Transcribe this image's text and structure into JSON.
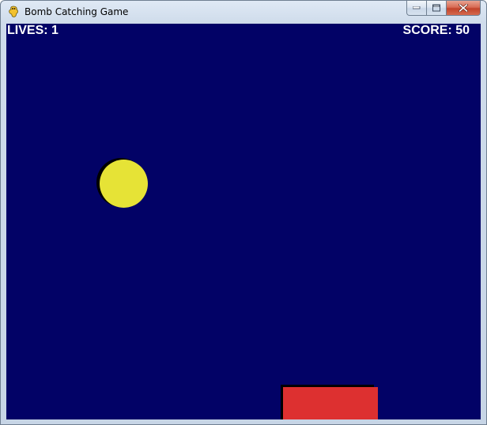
{
  "window": {
    "title": "Bomb Catching Game",
    "icon": "pygame-snake-icon",
    "controls": {
      "minimize": "minimize-icon",
      "maximize": "maximize-icon",
      "close": "close-icon"
    }
  },
  "game": {
    "lives_text": "LIVES: 1",
    "score_text": "SCORE: 50",
    "lives": 1,
    "score": 50,
    "colors": {
      "background": "#020266",
      "bomb": "#e6e336",
      "paddle": "#dd3030",
      "hud_text": "#ffffff"
    }
  }
}
